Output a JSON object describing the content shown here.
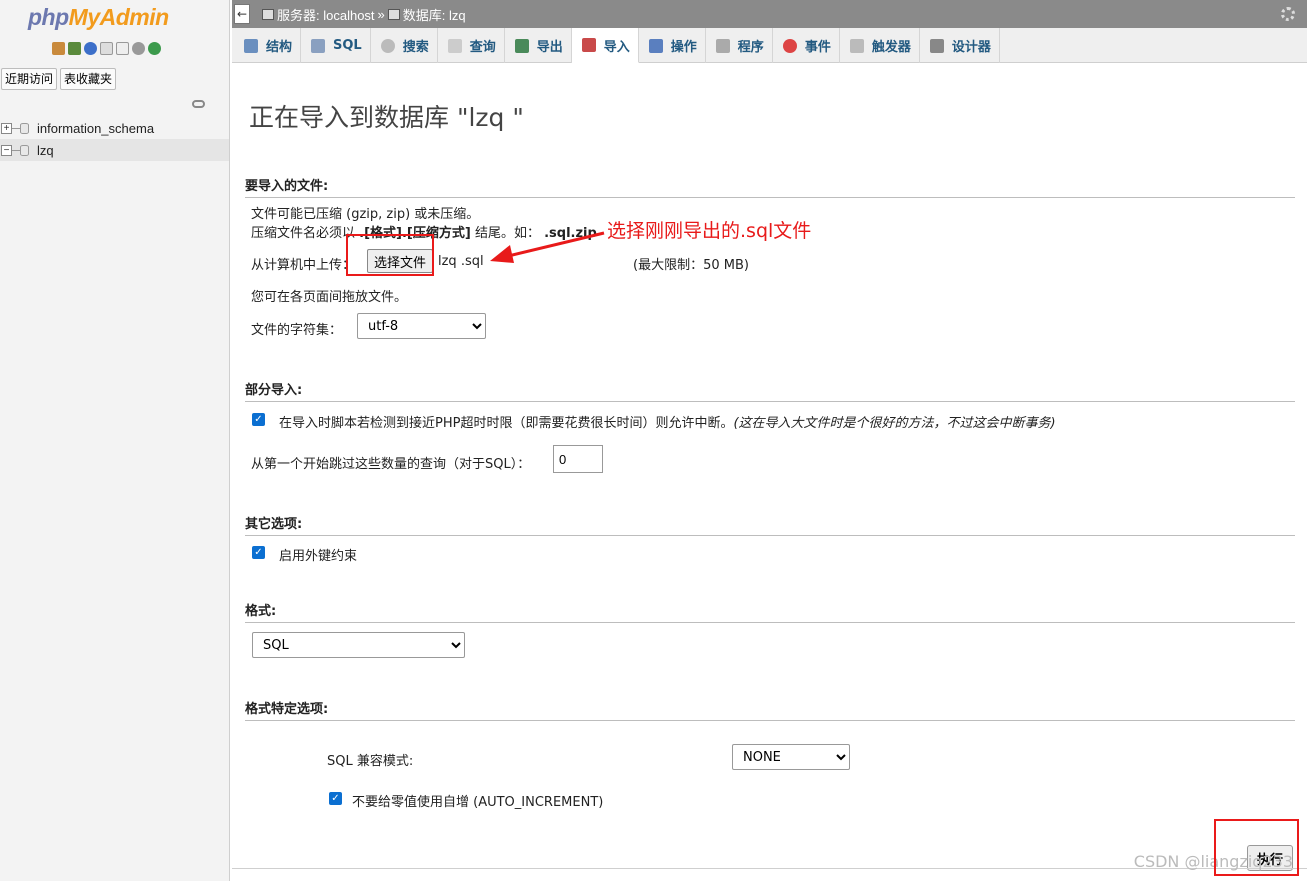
{
  "app": {
    "logo_php": "php",
    "logo_rest": "MyAdmin"
  },
  "sidebar": {
    "recent_button": "近期访问",
    "favorites_button": "表收藏夹",
    "databases": [
      {
        "name": "information_schema",
        "expander": "+"
      },
      {
        "name": "lzq",
        "expander": "−"
      }
    ]
  },
  "topbar": {
    "collapse": "←",
    "server_label": "服务器: localhost",
    "separator": "»",
    "db_label": "数据库: lzq"
  },
  "tabs": [
    {
      "label": "结构"
    },
    {
      "label": "SQL"
    },
    {
      "label": "搜索"
    },
    {
      "label": "查询"
    },
    {
      "label": "导出"
    },
    {
      "label": "导入"
    },
    {
      "label": "操作"
    },
    {
      "label": "程序"
    },
    {
      "label": "事件"
    },
    {
      "label": "触发器"
    },
    {
      "label": "设计器"
    }
  ],
  "page": {
    "title": "正在导入到数据库 \"lzq \""
  },
  "file_section": {
    "heading": "要导入的文件:",
    "compress_note": "文件可能已压缩 (gzip, zip) 或未压缩。",
    "name_note_prefix": "压缩文件名必须以",
    "name_note_format": ".[格式].[压缩方式]",
    "name_note_suffix": "结尾。如：",
    "name_note_example": ".sql.zip",
    "upload_label": "从计算机中上传：",
    "choose_file_button": "选择文件",
    "file_name": "lzq  .sql",
    "max_limit": "(最大限制：50 MB)",
    "drag_note": "您可在各页面间拖放文件。",
    "charset_label": "文件的字符集：",
    "charset_value": "utf-8"
  },
  "annotation": {
    "text": "选择刚刚导出的.sql文件"
  },
  "partial_section": {
    "heading": "部分导入:",
    "interrupt_label": "在导入时脚本若检测到接近PHP超时时限（即需要花费很长时间）则允许中断。",
    "interrupt_note": "(这在导入大文件时是个很好的方法，不过这会中断事务)",
    "skip_label": "从第一个开始跳过这些数量的查询（对于SQL）：",
    "skip_value": "0"
  },
  "other_section": {
    "heading": "其它选项:",
    "fk_label": "启用外键约束"
  },
  "format_section": {
    "heading": "格式:",
    "format_value": "SQL"
  },
  "format_options": {
    "heading": "格式特定选项:",
    "compat_label": "SQL 兼容模式:",
    "compat_value": "NONE",
    "autoinc_label": "不要给零值使用自增 (AUTO_INCREMENT)"
  },
  "footer": {
    "go_button": "执行",
    "watermark": "CSDN @liangziq233"
  },
  "colors": {
    "accent": "#235a81",
    "annotation": "#e81a1a",
    "checkbox": "#0b6fd1"
  }
}
